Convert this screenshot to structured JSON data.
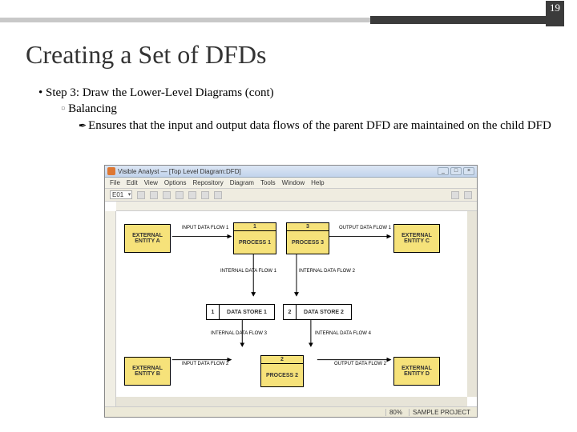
{
  "slide": {
    "number": "19",
    "title": "Creating a Set of DFDs",
    "bullet1": "Step 3: Draw the Lower-Level Diagrams (cont)",
    "bullet2": "Balancing",
    "bullet3": "Ensures that the input and output data flows of the parent DFD are maintained on the child DFD"
  },
  "app": {
    "title": "Visible Analyst — [Top Level Diagram:DFD]",
    "menus": [
      "File",
      "Edit",
      "View",
      "Options",
      "Repository",
      "Diagram",
      "Tools",
      "Window",
      "Help"
    ],
    "toolbar_select": "E01",
    "status_zoom": "80%",
    "status_project": "SAMPLE PROJECT"
  },
  "dfd": {
    "entityA": "EXTERNAL ENTITY A",
    "entityB": "EXTERNAL ENTITY B",
    "entityC": "EXTERNAL ENTITY C",
    "entityD": "EXTERNAL ENTITY D",
    "process1_num": "1",
    "process1_label": "PROCESS 1",
    "process2_num": "2",
    "process2_label": "PROCESS 2",
    "process3_num": "3",
    "process3_label": "PROCESS 3",
    "datastore1_num": "1",
    "datastore1_label": "DATA STORE 1",
    "datastore2_num": "2",
    "datastore2_label": "DATA STORE 2",
    "flow1": "INPUT DATA FLOW 1",
    "flow2": "OUTPUT DATA FLOW 1",
    "flow3": "INTERNAL DATA FLOW 1",
    "flow4": "INTERNAL DATA FLOW 2",
    "flow5": "INTERNAL DATA FLOW 3",
    "flow6": "INTERNAL DATA FLOW 4",
    "flow7": "INPUT DATA FLOW 2",
    "flow8": "OUTPUT DATA FLOW 2"
  }
}
